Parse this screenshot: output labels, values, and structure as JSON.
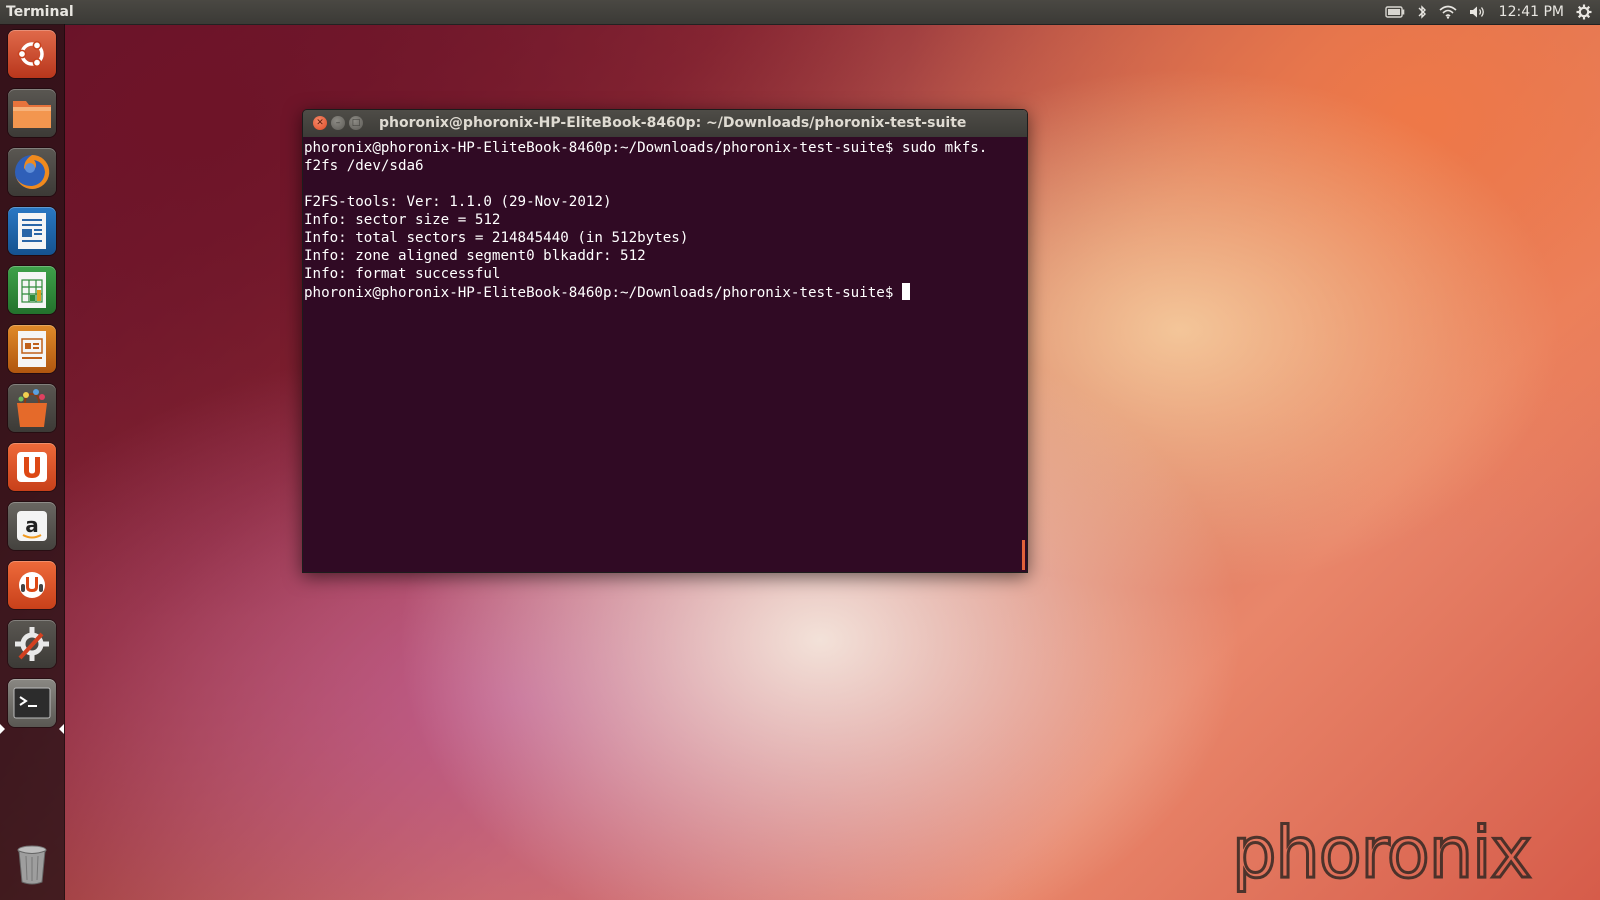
{
  "top_panel": {
    "app_title": "Terminal",
    "clock": "12:41 PM",
    "indicators": [
      "battery-icon",
      "bluetooth-icon",
      "wifi-icon",
      "volume-icon",
      "gear-icon"
    ]
  },
  "launcher": {
    "items": [
      {
        "name": "dash-home",
        "icon": "ubuntu-logo-icon"
      },
      {
        "name": "files",
        "icon": "folder-icon"
      },
      {
        "name": "firefox",
        "icon": "firefox-icon"
      },
      {
        "name": "libreoffice-writer",
        "icon": "writer-icon"
      },
      {
        "name": "libreoffice-calc",
        "icon": "calc-icon"
      },
      {
        "name": "libreoffice-impress",
        "icon": "impress-icon"
      },
      {
        "name": "software-center",
        "icon": "shopping-bag-icon"
      },
      {
        "name": "ubuntu-one",
        "icon": "ubuntu-one-icon"
      },
      {
        "name": "amazon",
        "icon": "amazon-icon"
      },
      {
        "name": "ubuntu-one-music",
        "icon": "music-store-icon"
      },
      {
        "name": "system-settings",
        "icon": "settings-icon"
      },
      {
        "name": "terminal",
        "icon": "terminal-icon",
        "active": true
      },
      {
        "name": "trash",
        "icon": "trash-icon"
      }
    ]
  },
  "terminal": {
    "title": "phoronix@phoronix-HP-EliteBook-8460p: ~/Downloads/phoronix-test-suite",
    "lines": [
      "phoronix@phoronix-HP-EliteBook-8460p:~/Downloads/phoronix-test-suite$ sudo mkfs.",
      "f2fs /dev/sda6",
      "",
      "F2FS-tools: Ver: 1.1.0 (29-Nov-2012)",
      "Info: sector size = 512",
      "Info: total sectors = 214845440 (in 512bytes)",
      "Info: zone aligned segment0 blkaddr: 512",
      "Info: format successful",
      "phoronix@phoronix-HP-EliteBook-8460p:~/Downloads/phoronix-test-suite$ "
    ],
    "colors": {
      "background": "#300a24",
      "text": "#ffffff"
    }
  },
  "watermark": "phoronix"
}
